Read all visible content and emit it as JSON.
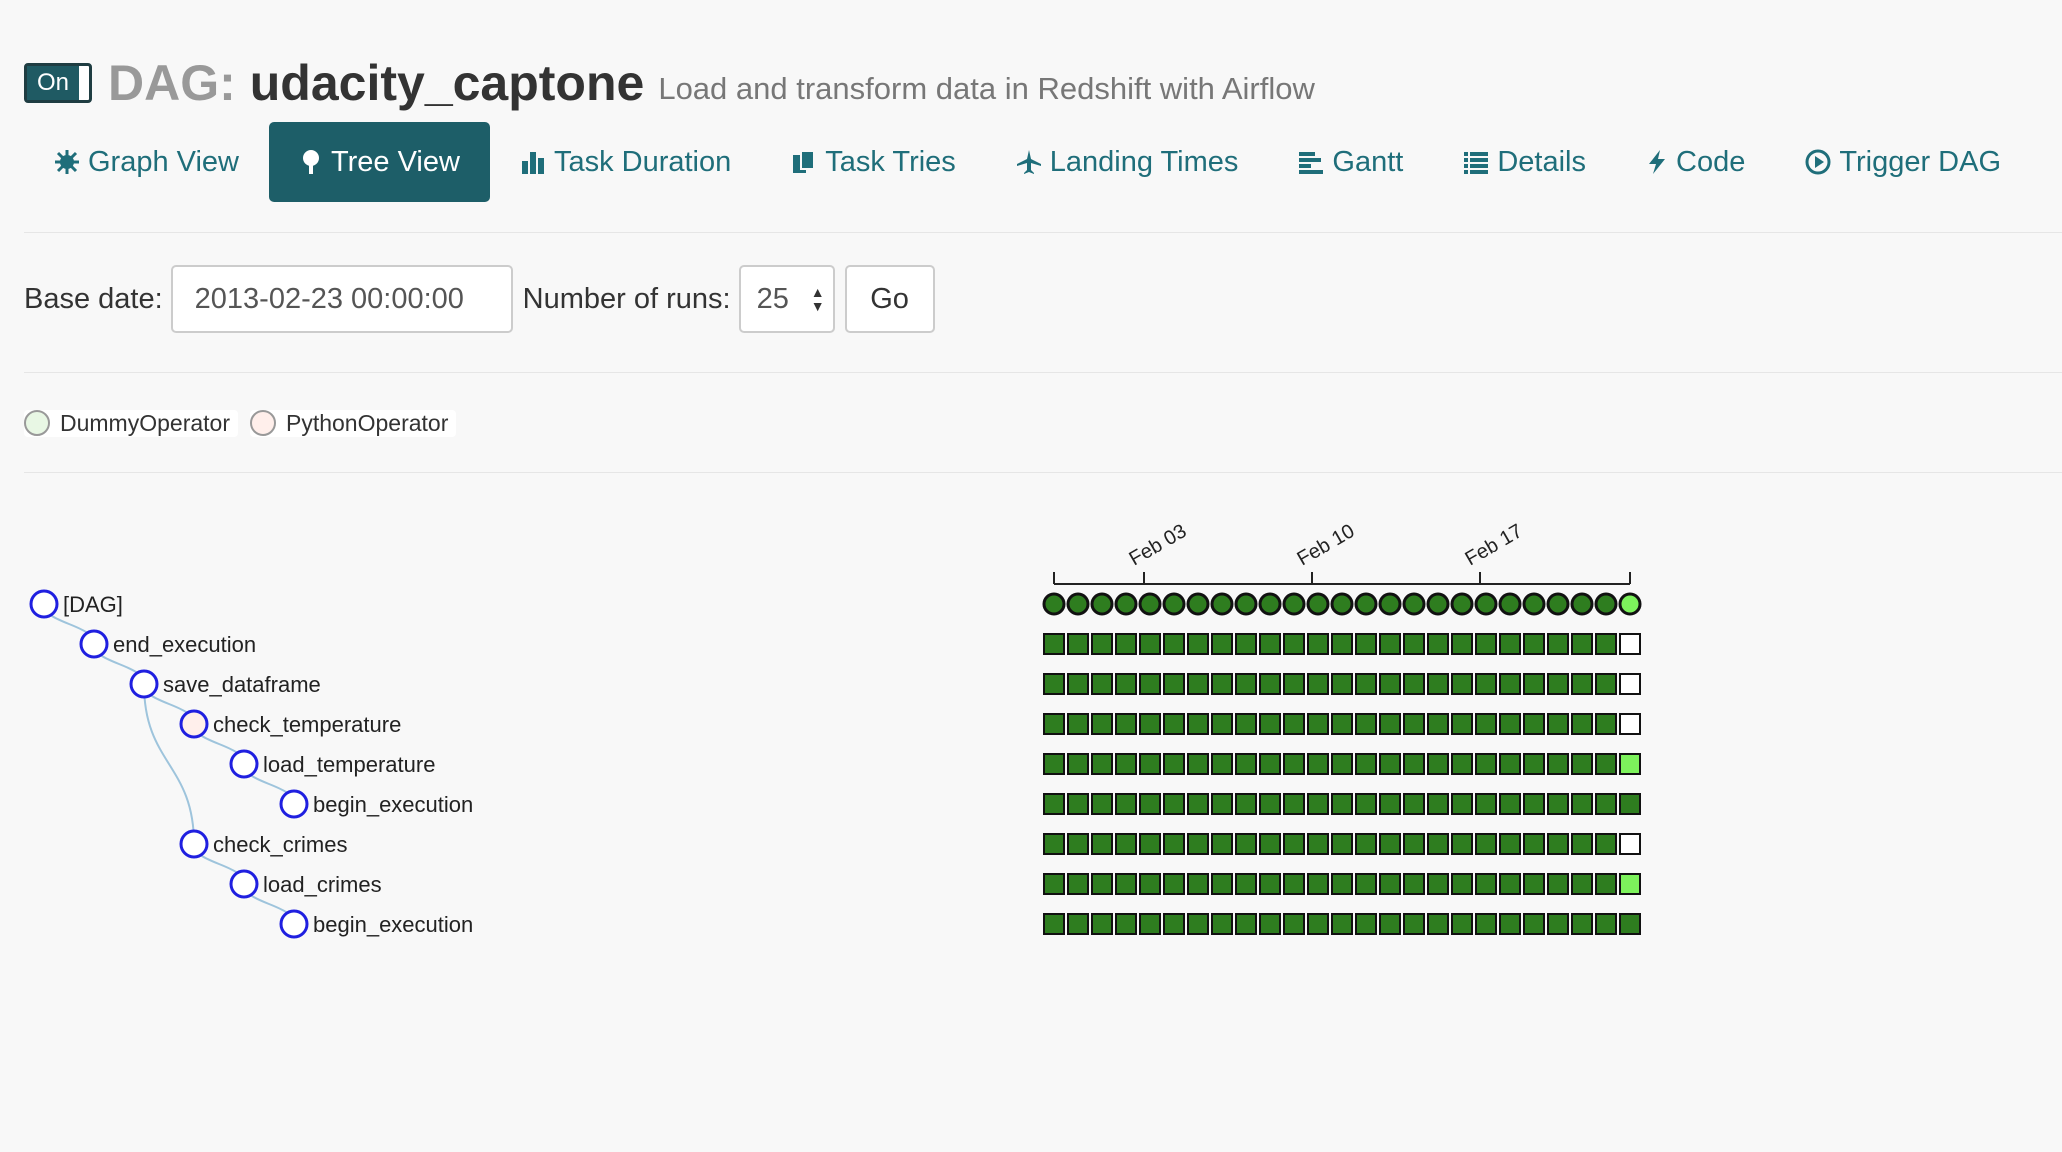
{
  "header": {
    "toggle_label": "On",
    "dag_prefix": "DAG:",
    "dag_id": "udacity_captone",
    "description": "Load and transform data in Redshift with Airflow"
  },
  "nav": [
    {
      "label": "Graph View",
      "icon": "graph-icon",
      "active": false
    },
    {
      "label": "Tree View",
      "icon": "tree-icon",
      "active": true
    },
    {
      "label": "Task Duration",
      "icon": "bar-chart-icon",
      "active": false
    },
    {
      "label": "Task Tries",
      "icon": "files-icon",
      "active": false
    },
    {
      "label": "Landing Times",
      "icon": "plane-icon",
      "active": false
    },
    {
      "label": "Gantt",
      "icon": "gantt-icon",
      "active": false
    },
    {
      "label": "Details",
      "icon": "list-icon",
      "active": false
    },
    {
      "label": "Code",
      "icon": "lightning-icon",
      "active": false
    },
    {
      "label": "Trigger DAG",
      "icon": "play-circle-icon",
      "active": false
    }
  ],
  "form": {
    "base_date_label": "Base date:",
    "base_date_value": "2013-02-23 00:00:00",
    "runs_label": "Number of runs:",
    "runs_value": "25",
    "go_label": "Go"
  },
  "legend": [
    {
      "label": "DummyOperator",
      "color": "#e8f7e4"
    },
    {
      "label": "PythonOperator",
      "color": "#ffefeb"
    }
  ],
  "tree": {
    "nodes": [
      {
        "label": "[DAG]",
        "depth": 0,
        "parent": null,
        "fill": "#ffffff"
      },
      {
        "label": "end_execution",
        "depth": 1,
        "parent": 0,
        "fill": "#ffffff"
      },
      {
        "label": "save_dataframe",
        "depth": 2,
        "parent": 1,
        "fill": "#ffffff"
      },
      {
        "label": "check_temperature",
        "depth": 3,
        "parent": 2,
        "fill": "#ffefeb"
      },
      {
        "label": "load_temperature",
        "depth": 4,
        "parent": 3,
        "fill": "#ffffff"
      },
      {
        "label": "begin_execution",
        "depth": 5,
        "parent": 4,
        "fill": "#ffffff"
      },
      {
        "label": "check_crimes",
        "depth": 3,
        "parent": 2,
        "fill": "#ffffff"
      },
      {
        "label": "load_crimes",
        "depth": 4,
        "parent": 6,
        "fill": "#ffffff"
      },
      {
        "label": "begin_execution",
        "depth": 5,
        "parent": 7,
        "fill": "#ffffff"
      }
    ],
    "axis_ticks": [
      {
        "label": "Feb 03",
        "run_index": 4
      },
      {
        "label": "Feb 10",
        "run_index": 11
      },
      {
        "label": "Feb 17",
        "run_index": 18
      }
    ],
    "run_count": 25,
    "state_colors": {
      "success": "#2e7d1f",
      "running": "#7df25c",
      "none": "#ffffff"
    },
    "last_run_states": [
      "running",
      "none",
      "none",
      "none",
      "running",
      "success",
      "none",
      "running",
      "success"
    ]
  }
}
